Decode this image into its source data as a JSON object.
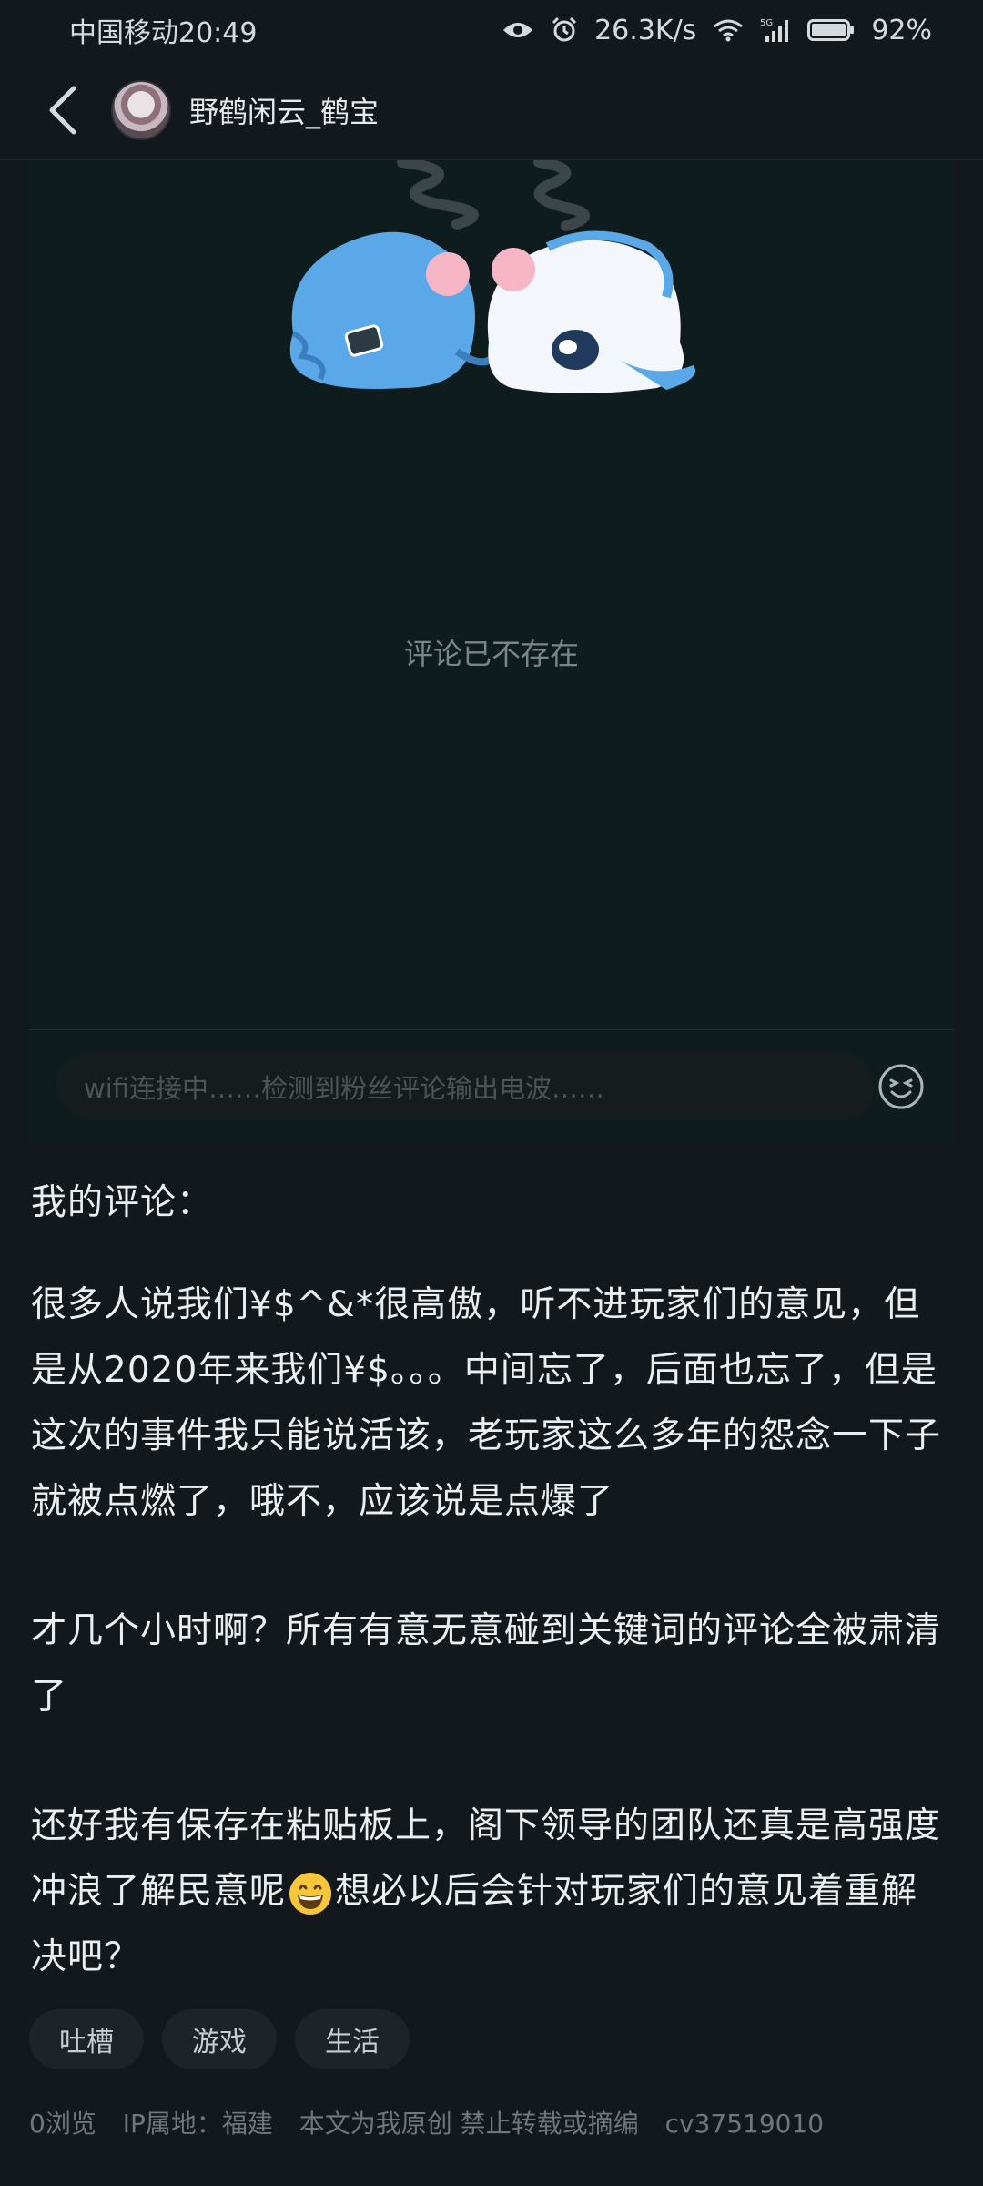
{
  "status_bar": {
    "carrier_time": "中国移动20:49",
    "net_speed": "26.3K/s",
    "battery": "92%"
  },
  "header": {
    "username": "野鹤闲云_鹤宝"
  },
  "embed": {
    "deleted_message": "评论已不存在",
    "input_placeholder": "wifi连接中……检测到粉丝评论输出电波……"
  },
  "article": {
    "heading": "我的评论：",
    "p1": "很多人说我们¥$^&*很高傲，听不进玩家们的意见，但是从2020年来我们¥$。。。中间忘了，后面也忘了，但是这次的事件我只能说活该，老玩家这么多年的怨念一下子就被点燃了，哦不，应该说是点爆了",
    "p2": "才几个小时啊？所有有意无意碰到关键词的评论全被肃清了",
    "p3_before": "还好我有保存在粘贴板上，阁下领导的团队还真是高强度冲浪了解民意呢",
    "p3_after": "想必以后会针对玩家们的意见着重解决吧？"
  },
  "tags": [
    "吐槽",
    "游戏",
    "生活"
  ],
  "meta": {
    "views": "0浏览",
    "ip": "IP属地：福建",
    "copyright": "本文为我原创 禁止转载或摘编",
    "cv_id": "cv37519010"
  },
  "colors": {
    "background": "#12181c",
    "embed_bg": "#0f1c1e",
    "mascot_blue": "#5aa8e8"
  }
}
